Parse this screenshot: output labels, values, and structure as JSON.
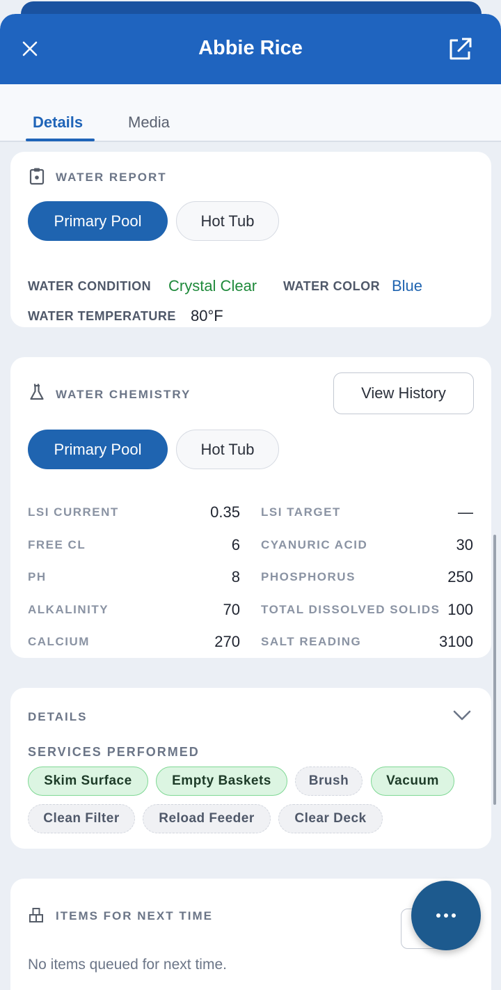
{
  "header": {
    "title": "Abbie Rice",
    "close_icon": "close-icon",
    "open_icon": "external-link-icon"
  },
  "tabs": [
    {
      "label": "Details",
      "active": true
    },
    {
      "label": "Media",
      "active": false
    }
  ],
  "water_report": {
    "title": "WATER REPORT",
    "icon": "clipboard-icon",
    "segments": [
      "Primary Pool",
      "Hot Tub"
    ],
    "selected_segment": "Primary Pool",
    "condition_label": "WATER CONDITION",
    "condition_value": "Crystal Clear",
    "color_label": "WATER COLOR",
    "color_value": "Blue",
    "temperature_label": "WATER TEMPERATURE",
    "temperature_value": "80°F"
  },
  "water_chemistry": {
    "title": "WATER CHEMISTRY",
    "icon": "flask-icon",
    "view_history_label": "View History",
    "segments": [
      "Primary Pool",
      "Hot Tub"
    ],
    "selected_segment": "Primary Pool",
    "readings": [
      {
        "label": "LSI CURRENT",
        "value": "0.35"
      },
      {
        "label": "LSI TARGET",
        "value": "—"
      },
      {
        "label": "FREE CL",
        "value": "6"
      },
      {
        "label": "CYANURIC ACID",
        "value": "30"
      },
      {
        "label": "PH",
        "value": "8"
      },
      {
        "label": "PHOSPHORUS",
        "value": "250"
      },
      {
        "label": "ALKALINITY",
        "value": "70"
      },
      {
        "label": "TOTAL DISSOLVED SOLIDS",
        "value": "100"
      },
      {
        "label": "CALCIUM",
        "value": "270"
      },
      {
        "label": "SALT READING",
        "value": "3100"
      }
    ]
  },
  "details": {
    "title": "DETAILS",
    "chevron_icon": "chevron-down-icon",
    "services_label": "SERVICES PERFORMED",
    "services": [
      {
        "label": "Skim Surface",
        "done": true
      },
      {
        "label": "Empty Baskets",
        "done": true
      },
      {
        "label": "Brush",
        "done": false
      },
      {
        "label": "Vacuum",
        "done": true
      },
      {
        "label": "Clean Filter",
        "done": false
      },
      {
        "label": "Reload Feeder",
        "done": false
      },
      {
        "label": "Clear Deck",
        "done": false
      }
    ]
  },
  "next_time": {
    "title": "ITEMS FOR NEXT TIME",
    "icon": "boxes-icon",
    "empty_text": "No items queued for next time."
  },
  "fab": {
    "icon": "more-horizontal-icon"
  },
  "colors": {
    "header": "#1f64bf",
    "accent": "#1f64b0",
    "success": "#1f8a3b",
    "fab": "#1d5a8e"
  }
}
